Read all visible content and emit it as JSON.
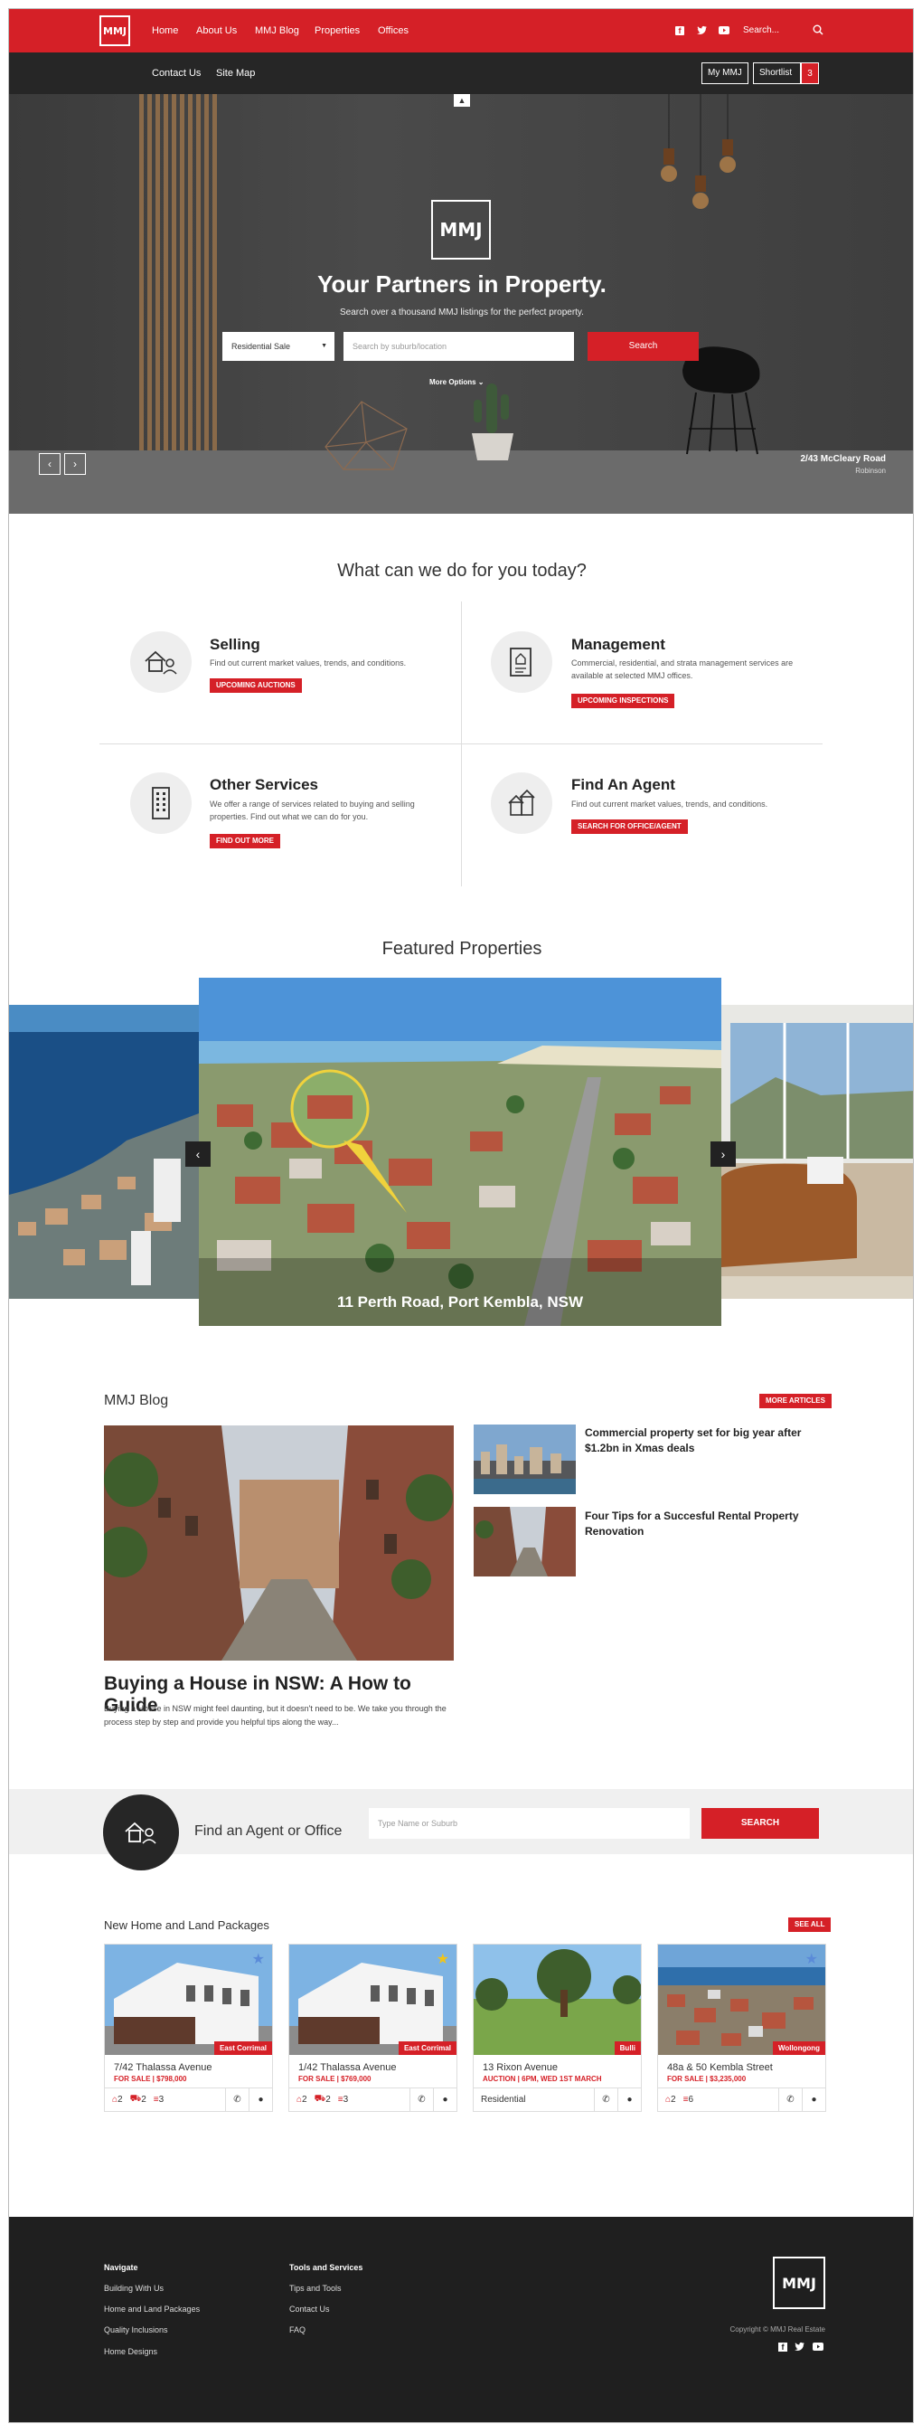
{
  "nav": {
    "logo": "MMJ",
    "items": [
      "Home",
      "About Us",
      "MMJ Blog",
      "Properties",
      "Offices"
    ],
    "search_placeholder": "Search...",
    "sub_items": [
      "Contact Us",
      "Site Map"
    ],
    "my_mmj": "My MMJ",
    "shortlist": "Shortlist",
    "shortlist_count": "3"
  },
  "hero": {
    "title": "Your Partners in Property.",
    "subtitle": "Search over a thousand MMJ listings for the perfect property.",
    "select_value": "Residential Sale",
    "search_placeholder": "Search by suburb/location",
    "search_button": "Search",
    "more_options": "More Options",
    "caption_address": "2/43 McCleary Road",
    "caption_suburb": "Robinson"
  },
  "services": {
    "heading": "What can we do for you today?",
    "items": [
      {
        "title": "Selling",
        "text": "Find out current market values, trends, and conditions.",
        "button": "UPCOMING AUCTIONS"
      },
      {
        "title": "Management",
        "text": "Commercial, residential, and strata management services are available at selected MMJ offices.",
        "button": "UPCOMING INSPECTIONS"
      },
      {
        "title": "Other Services",
        "text": "We offer a range of services related to buying and selling properties. Find out what we can do for you.",
        "button": "FIND OUT MORE"
      },
      {
        "title": "Find An Agent",
        "text": "Find out current market values, trends, and conditions.",
        "button": "SEARCH FOR OFFICE/AGENT"
      }
    ]
  },
  "featured": {
    "heading": "Featured Properties",
    "caption": "11 Perth Road, Port Kembla, NSW"
  },
  "blog": {
    "heading": "MMJ Blog",
    "more_button": "MORE ARTICLES",
    "main_title": "Buying a House in NSW: A How to Guide",
    "main_excerpt": "Buying a House in NSW might feel daunting, but it doesn't need to be. We take you through the process step by step and provide you helpful tips along the way...",
    "side_articles": [
      {
        "title": "Commercial property set for big year after $1.2bn in Xmas deals"
      },
      {
        "title": "Four Tips for a Succesful Rental Property Renovation"
      }
    ]
  },
  "agent_band": {
    "title": "Find an Agent or Office",
    "placeholder": "Type Name or Suburb",
    "button": "SEARCH"
  },
  "packages": {
    "heading": "New Home and Land Packages",
    "see_all": "SEE ALL",
    "cards": [
      {
        "location": "East Corrimal",
        "address": "7/42 Thalassa Avenue",
        "price": "FOR SALE | $798,000",
        "beds": "2",
        "cars": "2",
        "baths": "3",
        "type": ""
      },
      {
        "location": "East Corrimal",
        "address": "1/42 Thalassa Avenue",
        "price": "FOR SALE | $769,000",
        "beds": "2",
        "cars": "2",
        "baths": "3",
        "type": ""
      },
      {
        "location": "Bulli",
        "address": "13 Rixon Avenue",
        "price": "AUCTION | 6PM, WED 1ST MARCH",
        "beds": "",
        "cars": "",
        "baths": "",
        "type": "Residential"
      },
      {
        "location": "Wollongong",
        "address": "48a & 50 Kembla Street",
        "price": "FOR SALE | $3,235,000",
        "beds": "2",
        "cars": "",
        "baths": "6",
        "type": ""
      }
    ]
  },
  "footer": {
    "col1_heading": "Navigate",
    "col1_links": [
      "Building With Us",
      "Home and Land Packages",
      "Quality Inclusions",
      "Home Designs"
    ],
    "col2_heading": "Tools and Services",
    "col2_links": [
      "Tips and Tools",
      "Contact Us",
      "FAQ"
    ],
    "copyright": "Copyright © MMJ Real Estate",
    "logo": "MMJ"
  },
  "colors": {
    "brand_red": "#d52027",
    "dark": "#262626",
    "footer": "#1f1f1f"
  }
}
